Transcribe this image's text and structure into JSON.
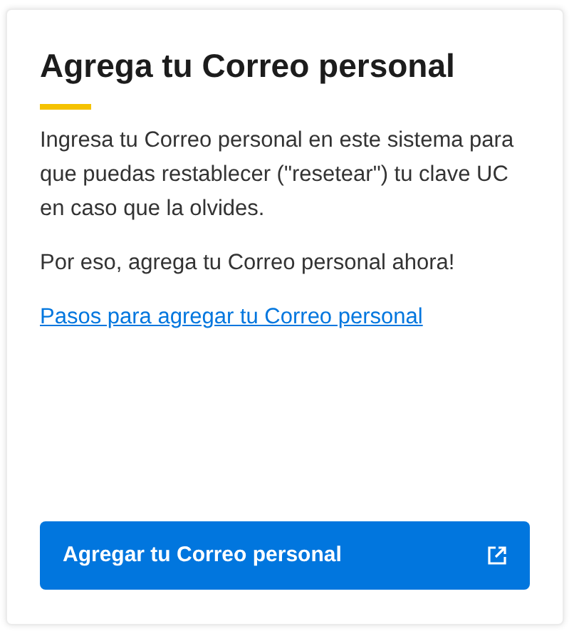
{
  "card": {
    "title": "Agrega tu Correo personal",
    "paragraphs": [
      "Ingresa tu Correo personal en este sistema para que puedas restablecer (\"resetear\") tu clave UC en caso que la olvides.",
      "Por eso, agrega tu Correo personal ahora!"
    ],
    "link": "Pasos para agregar tu Correo personal",
    "button": "Agregar tu Correo personal"
  }
}
